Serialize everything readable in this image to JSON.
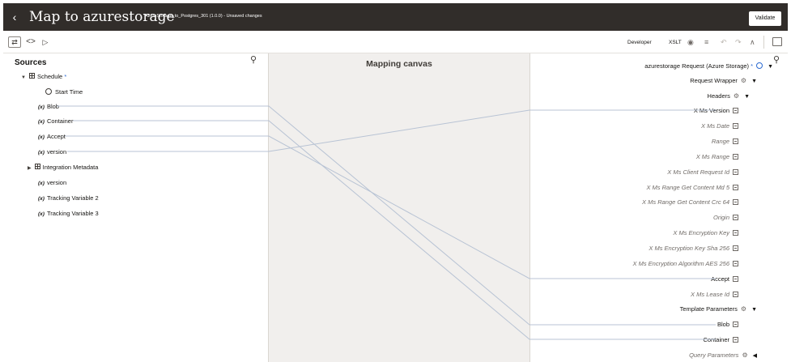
{
  "header": {
    "back_icon": "chevron-left-icon",
    "title": "Map to azurestorage",
    "subtitle": "AzureStorage_to_Postgres_301 (1.0.0) - Unsaved changes",
    "validate_label": "Validate"
  },
  "toolbar": {
    "developer_label": "Developer",
    "xslt_label": "XSLT",
    "icons": [
      "swap-icon",
      "code-icon",
      "play-icon",
      "eye-icon",
      "filter-icon",
      "undo-icon",
      "redo-icon",
      "collapse-icon",
      "panel-icon"
    ]
  },
  "canvas": {
    "label": "Mapping canvas"
  },
  "sources": {
    "title": "Sources",
    "items": [
      {
        "label": "Schedule",
        "required": "*"
      },
      {
        "label": "Start Time"
      },
      {
        "prefix": "(x)",
        "label": "Blob"
      },
      {
        "prefix": "(x)",
        "label": "Container"
      },
      {
        "prefix": "(x)",
        "label": "Accept"
      },
      {
        "prefix": "(x)",
        "label": "version"
      },
      {
        "label": "Integration Metadata"
      },
      {
        "prefix": "(x)",
        "label": "version"
      },
      {
        "prefix": "(x)",
        "label": "Tracking Variable 2"
      },
      {
        "prefix": "(x)",
        "label": "Tracking Variable 3"
      }
    ]
  },
  "target": {
    "root": {
      "label": "azurestorage Request (Azure Storage)",
      "required": "*"
    },
    "items": [
      {
        "label": "Request Wrapper"
      },
      {
        "label": "Headers"
      },
      {
        "label": "X Ms Version"
      },
      {
        "label": "X Ms Date"
      },
      {
        "label": "Range"
      },
      {
        "label": "X Ms Range"
      },
      {
        "label": "X Ms Client Request Id"
      },
      {
        "label": "X Ms Range Get Content Md 5"
      },
      {
        "label": "X Ms Range Get Content Crc 64"
      },
      {
        "label": "Origin"
      },
      {
        "label": "X Ms Encryption Key"
      },
      {
        "label": "X Ms Encryption Key Sha 256"
      },
      {
        "label": "X Ms Encryption Algorithm AES 256"
      },
      {
        "label": "Accept"
      },
      {
        "label": "X Ms Lease Id"
      },
      {
        "label": "Template Parameters"
      },
      {
        "label": "Blob"
      },
      {
        "label": "Container"
      },
      {
        "label": "Query Parameters"
      }
    ]
  },
  "colors": {
    "header_bg": "#312d2a",
    "required": "#2c6bd2",
    "canvas_bg": "#f1efed",
    "mapping_line": "#b8c3d4"
  }
}
